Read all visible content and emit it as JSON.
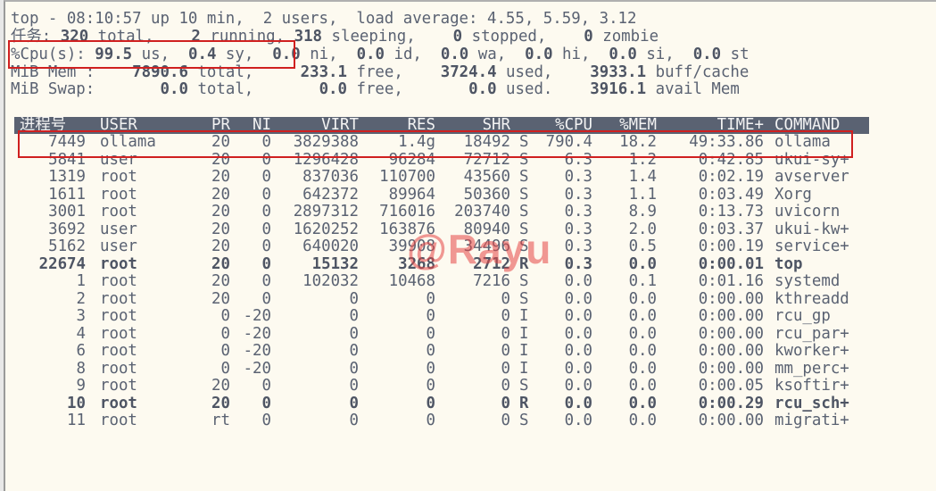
{
  "summary": {
    "line1": "top - 08:10:57 up 10 min,  2 users,  load average: 4.55, 5.59, 3.12",
    "line2": {
      "label": "任务:",
      "total": "320",
      "total_label": "total,",
      "running": "2",
      "running_label": "running,",
      "sleeping": "318",
      "sleeping_label": "sleeping,",
      "stopped": "0",
      "stopped_label": "stopped,",
      "zombie": "0",
      "zombie_label": "zombie"
    },
    "cpu": {
      "label": "%Cpu(s):",
      "us": "99.5",
      "us_label": "us,",
      "sy": "0.4",
      "sy_label": "sy,",
      "ni": "0.0",
      "ni_label": "ni,",
      "id": "0.0",
      "id_label": "id,",
      "wa": "0.0",
      "wa_label": "wa,",
      "hi": "0.0",
      "hi_label": "hi,",
      "si": "0.0",
      "si_label": "si,",
      "st": "0.0",
      "st_label": "st"
    },
    "mem": {
      "label": "MiB Mem :",
      "total": "7890.6",
      "total_label": "total,",
      "free": "233.1",
      "free_label": "free,",
      "used": "3724.4",
      "used_label": "used,",
      "buff": "3933.1",
      "buff_label": "buff/cache"
    },
    "swap": {
      "label": "MiB Swap:",
      "total": "0.0",
      "total_label": "total,",
      "free": "0.0",
      "free_label": "free,",
      "used": "0.0",
      "used_label": "used.",
      "avail": "3916.1",
      "avail_label": "avail Mem"
    }
  },
  "table": {
    "headers": [
      "进程号",
      "USER",
      "PR",
      "NI",
      "VIRT",
      "RES",
      "SHR",
      "",
      "%CPU",
      "%MEM",
      "TIME+",
      "COMMAND"
    ],
    "rows": [
      {
        "pid": "7449",
        "user": "ollama",
        "pr": "20",
        "ni": "0",
        "virt": "3829388",
        "res": "1.4g",
        "shr": "18492",
        "s": "S",
        "cpu": "790.4",
        "mem": "18.2",
        "time": "49:33.86",
        "cmd": "ollama",
        "bold": false
      },
      {
        "pid": "5841",
        "user": "user",
        "pr": "20",
        "ni": "0",
        "virt": "1296428",
        "res": "96284",
        "shr": "72712",
        "s": "S",
        "cpu": "6.3",
        "mem": "1.2",
        "time": "0:42.85",
        "cmd": "ukui-sy+",
        "bold": false
      },
      {
        "pid": "1319",
        "user": "root",
        "pr": "20",
        "ni": "0",
        "virt": "837036",
        "res": "110700",
        "shr": "43560",
        "s": "S",
        "cpu": "0.3",
        "mem": "1.4",
        "time": "0:02.19",
        "cmd": "avserver",
        "bold": false
      },
      {
        "pid": "1611",
        "user": "root",
        "pr": "20",
        "ni": "0",
        "virt": "642372",
        "res": "89964",
        "shr": "50360",
        "s": "S",
        "cpu": "0.3",
        "mem": "1.1",
        "time": "0:03.49",
        "cmd": "Xorg",
        "bold": false
      },
      {
        "pid": "3001",
        "user": "root",
        "pr": "20",
        "ni": "0",
        "virt": "2897312",
        "res": "716016",
        "shr": "203740",
        "s": "S",
        "cpu": "0.3",
        "mem": "8.9",
        "time": "0:13.73",
        "cmd": "uvicorn",
        "bold": false
      },
      {
        "pid": "3692",
        "user": "user",
        "pr": "20",
        "ni": "0",
        "virt": "1620252",
        "res": "163876",
        "shr": "80940",
        "s": "S",
        "cpu": "0.3",
        "mem": "2.0",
        "time": "0:03.37",
        "cmd": "ukui-kw+",
        "bold": false
      },
      {
        "pid": "5162",
        "user": "user",
        "pr": "20",
        "ni": "0",
        "virt": "640020",
        "res": "39908",
        "shr": "34496",
        "s": "S",
        "cpu": "0.3",
        "mem": "0.5",
        "time": "0:00.19",
        "cmd": "service+",
        "bold": false
      },
      {
        "pid": "22674",
        "user": "root",
        "pr": "20",
        "ni": "0",
        "virt": "15132",
        "res": "3268",
        "shr": "2712",
        "s": "R",
        "cpu": "0.3",
        "mem": "0.0",
        "time": "0:00.01",
        "cmd": "top",
        "bold": true
      },
      {
        "pid": "1",
        "user": "root",
        "pr": "20",
        "ni": "0",
        "virt": "102032",
        "res": "10468",
        "shr": "7216",
        "s": "S",
        "cpu": "0.0",
        "mem": "0.1",
        "time": "0:01.16",
        "cmd": "systemd",
        "bold": false
      },
      {
        "pid": "2",
        "user": "root",
        "pr": "20",
        "ni": "0",
        "virt": "0",
        "res": "0",
        "shr": "0",
        "s": "S",
        "cpu": "0.0",
        "mem": "0.0",
        "time": "0:00.00",
        "cmd": "kthreadd",
        "bold": false
      },
      {
        "pid": "3",
        "user": "root",
        "pr": "0",
        "ni": "-20",
        "virt": "0",
        "res": "0",
        "shr": "0",
        "s": "I",
        "cpu": "0.0",
        "mem": "0.0",
        "time": "0:00.00",
        "cmd": "rcu_gp",
        "bold": false
      },
      {
        "pid": "4",
        "user": "root",
        "pr": "0",
        "ni": "-20",
        "virt": "0",
        "res": "0",
        "shr": "0",
        "s": "I",
        "cpu": "0.0",
        "mem": "0.0",
        "time": "0:00.00",
        "cmd": "rcu_par+",
        "bold": false
      },
      {
        "pid": "6",
        "user": "root",
        "pr": "0",
        "ni": "-20",
        "virt": "0",
        "res": "0",
        "shr": "0",
        "s": "I",
        "cpu": "0.0",
        "mem": "0.0",
        "time": "0:00.00",
        "cmd": "kworker+",
        "bold": false
      },
      {
        "pid": "8",
        "user": "root",
        "pr": "0",
        "ni": "-20",
        "virt": "0",
        "res": "0",
        "shr": "0",
        "s": "I",
        "cpu": "0.0",
        "mem": "0.0",
        "time": "0:00.00",
        "cmd": "mm_perc+",
        "bold": false
      },
      {
        "pid": "9",
        "user": "root",
        "pr": "20",
        "ni": "0",
        "virt": "0",
        "res": "0",
        "shr": "0",
        "s": "S",
        "cpu": "0.0",
        "mem": "0.0",
        "time": "0:00.05",
        "cmd": "ksoftir+",
        "bold": false
      },
      {
        "pid": "10",
        "user": "root",
        "pr": "20",
        "ni": "0",
        "virt": "0",
        "res": "0",
        "shr": "0",
        "s": "R",
        "cpu": "0.0",
        "mem": "0.0",
        "time": "0:00.29",
        "cmd": "rcu_sch+",
        "bold": true
      },
      {
        "pid": "11",
        "user": "root",
        "pr": "rt",
        "ni": "0",
        "virt": "0",
        "res": "0",
        "shr": "0",
        "s": "S",
        "cpu": "0.0",
        "mem": "0.0",
        "time": "0:00.00",
        "cmd": "migrati+",
        "bold": false
      }
    ]
  },
  "watermark": "@Rayu",
  "colors": {
    "text": "#5a6272",
    "background": "#fdfaf0",
    "header_bar": "#5a6272",
    "highlight": "#d02020",
    "watermark": "#e64646"
  }
}
